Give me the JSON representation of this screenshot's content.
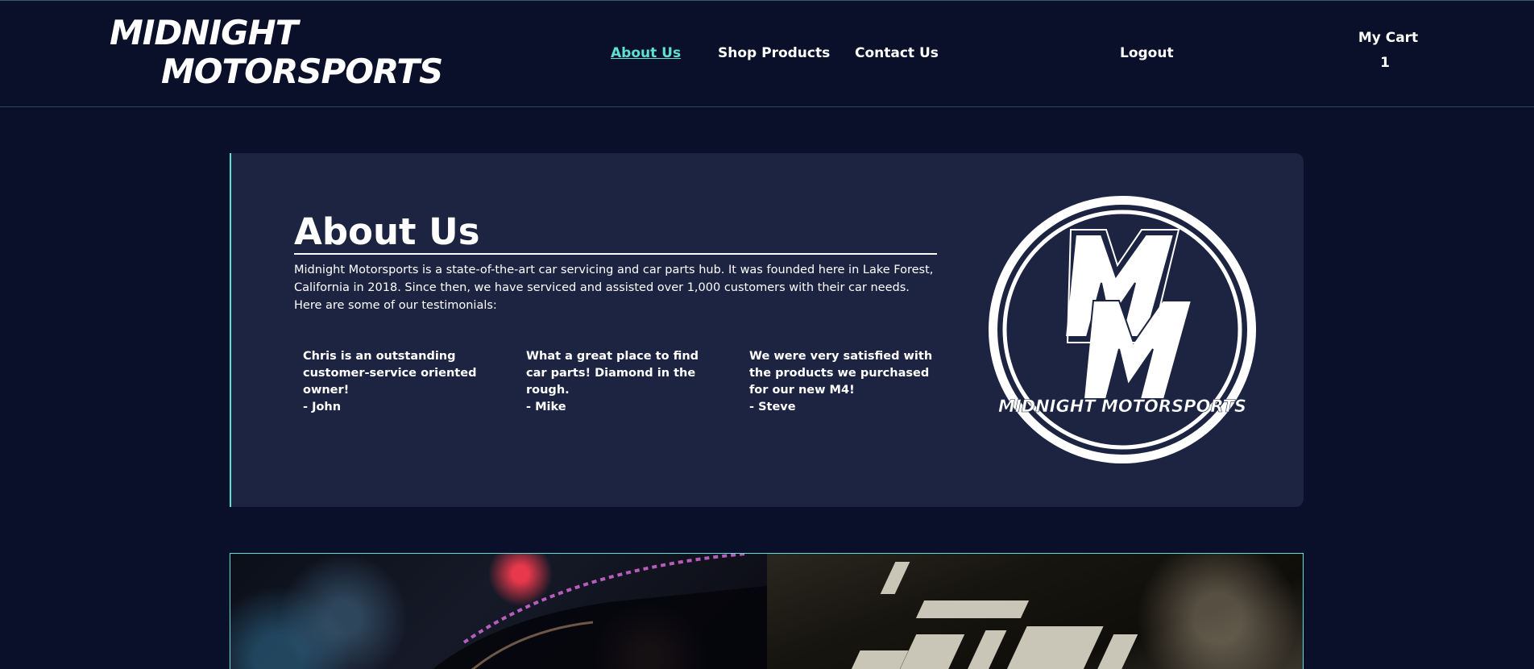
{
  "header": {
    "brand_line1": "MIDNIGHT",
    "brand_line2": "MOTORSPORTS",
    "nav": [
      {
        "label": "About Us",
        "active": true
      },
      {
        "label": "Shop Products",
        "active": false
      },
      {
        "label": "Contact Us",
        "active": false
      },
      {
        "label": "Logout",
        "active": false
      }
    ],
    "cart": {
      "label": "My Cart",
      "count": "1"
    }
  },
  "about": {
    "title": "About Us",
    "text": "Midnight Motorsports is a state-of-the-art car servicing and car parts hub. It was founded here in Lake Forest, California in 2018. Since then, we have serviced and assisted over 1,000 customers with their car needs. Here are some of our testimonials:",
    "testimonials": [
      {
        "quote": "Chris is an outstanding customer-service oriented owner!",
        "author": "- John"
      },
      {
        "quote": "What a great place to find car parts! Diamond in the rough.",
        "author": "- Mike"
      },
      {
        "quote": "We were very satisfied with the products we purchased for our new M4!",
        "author": "- Steve"
      }
    ],
    "logo": {
      "monogram": "MM",
      "text": "MIDNIGHT MOTORSPORTS"
    }
  },
  "colors": {
    "background": "#0a102a",
    "card": "#1c2442",
    "accent": "#5fe0d5",
    "text": "#ffffff"
  }
}
